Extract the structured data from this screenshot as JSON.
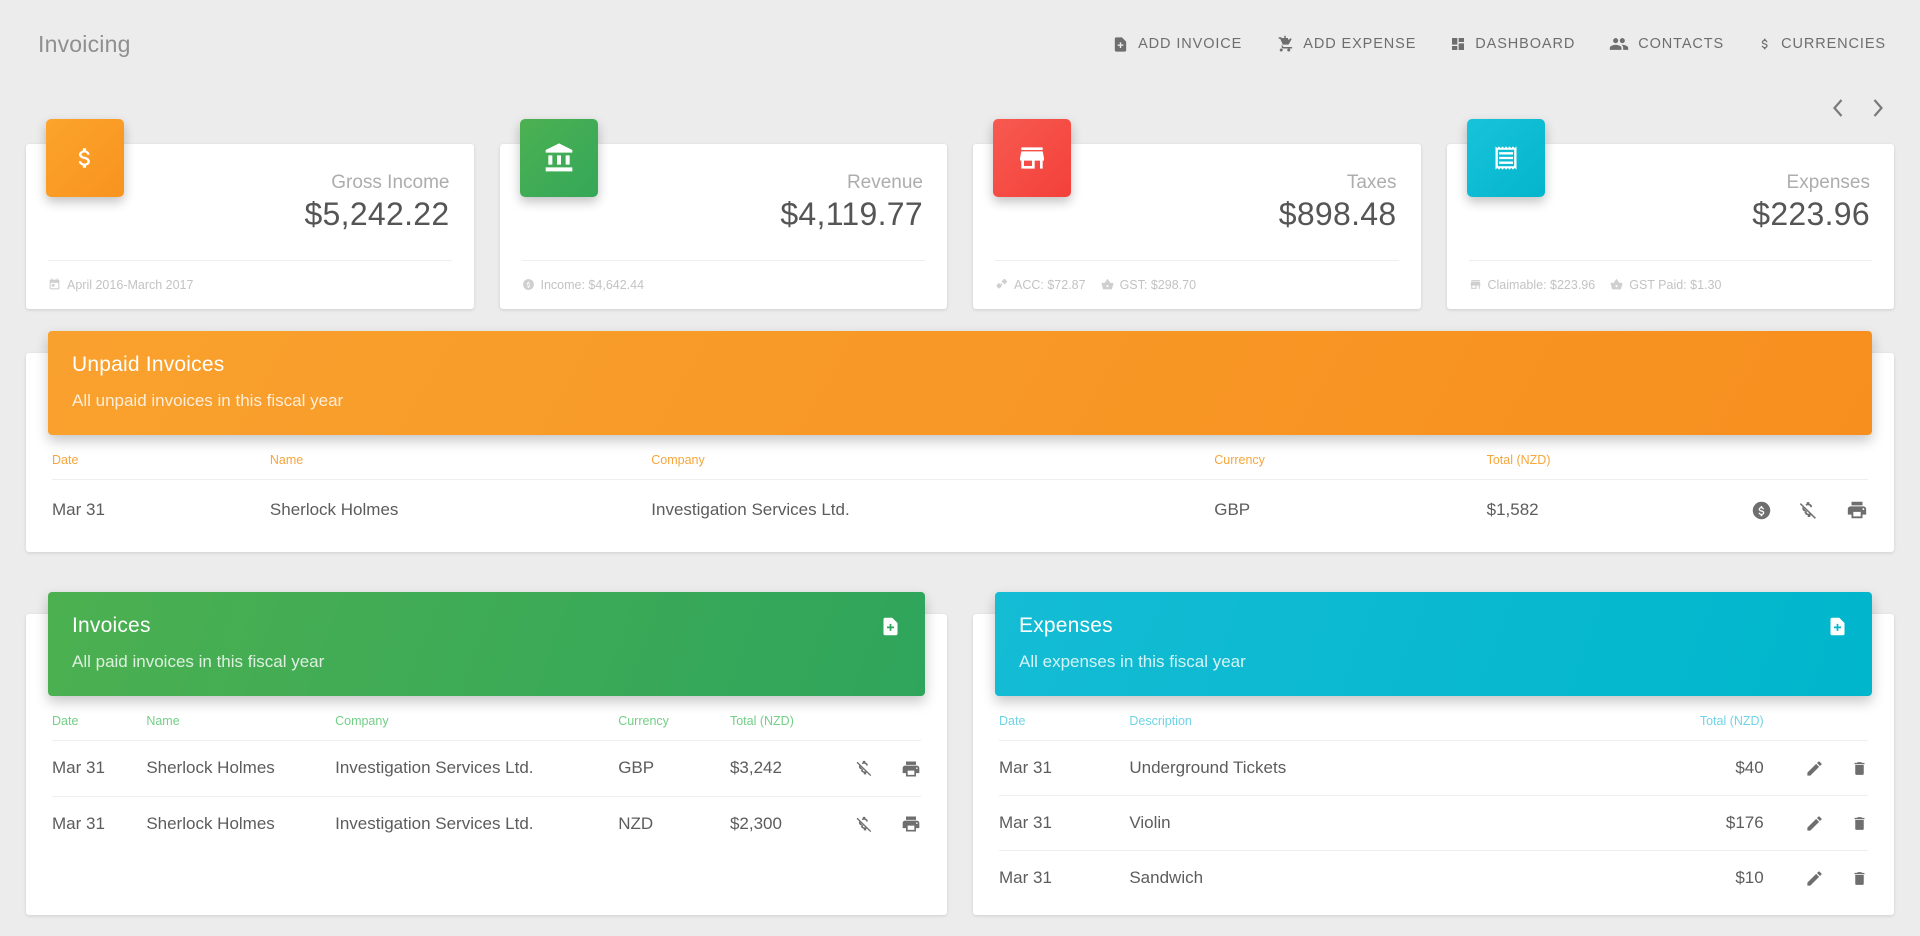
{
  "app": {
    "title": "Invoicing"
  },
  "nav": {
    "items": [
      {
        "label": "ADD INVOICE",
        "icon": "file-add-icon"
      },
      {
        "label": "ADD EXPENSE",
        "icon": "cart-add-icon"
      },
      {
        "label": "DASHBOARD",
        "icon": "dashboard-icon"
      },
      {
        "label": "CONTACTS",
        "icon": "contacts-icon"
      },
      {
        "label": "CURRENCIES",
        "icon": "dollar-sign-icon"
      }
    ]
  },
  "pager": {
    "prev": "chevron-left-icon",
    "next": "chevron-right-icon"
  },
  "cards": [
    {
      "label": "Gross Income",
      "value": "$5,242.22",
      "color": "#f89b24",
      "icon": "dollar-sign-icon",
      "footer": [
        {
          "icon": "calendar-icon",
          "text": "April 2016-March 2017"
        }
      ]
    },
    {
      "label": "Revenue",
      "value": "$4,119.77",
      "color": "#3aa856",
      "icon": "bank-icon",
      "footer": [
        {
          "icon": "dollar-circle-icon",
          "text": "Income: $4,642.44"
        }
      ]
    },
    {
      "label": "Taxes",
      "value": "$898.48",
      "color": "#f4463f",
      "icon": "store-icon",
      "footer": [
        {
          "icon": "bandage-icon",
          "text": "ACC: $72.87"
        },
        {
          "icon": "basket-icon",
          "text": "GST: $298.70"
        }
      ]
    },
    {
      "label": "Expenses",
      "value": "$223.96",
      "color": "#0cbcd5",
      "icon": "receipt-icon",
      "footer": [
        {
          "icon": "store-icon",
          "text": "Claimable: $223.96"
        },
        {
          "icon": "basket-icon",
          "text": "GST Paid: $1.30"
        }
      ]
    }
  ],
  "unpaid": {
    "title": "Unpaid Invoices",
    "subtitle": "All unpaid invoices in this fiscal year",
    "columns": [
      "Date",
      "Name",
      "Company",
      "Currency",
      "Total (NZD)"
    ],
    "rows": [
      {
        "date": "Mar 31",
        "name": "Sherlock Holmes",
        "company": "Investigation Services Ltd.",
        "currency": "GBP",
        "total": "$1,582",
        "actions": [
          "dollar-circle-icon",
          "dollar-slash-icon",
          "print-icon"
        ]
      }
    ]
  },
  "invoices": {
    "title": "Invoices",
    "subtitle": "All paid invoices in this fiscal year",
    "add_icon": "file-add-icon",
    "columns": [
      "Date",
      "Name",
      "Company",
      "Currency",
      "Total (NZD)"
    ],
    "rows": [
      {
        "date": "Mar 31",
        "name": "Sherlock Holmes",
        "company": "Investigation Services Ltd.",
        "currency": "GBP",
        "total": "$3,242",
        "actions": [
          "dollar-slash-icon",
          "print-icon"
        ]
      },
      {
        "date": "Mar 31",
        "name": "Sherlock Holmes",
        "company": "Investigation Services Ltd.",
        "currency": "NZD",
        "total": "$2,300",
        "actions": [
          "dollar-slash-icon",
          "print-icon"
        ]
      }
    ]
  },
  "expenses": {
    "title": "Expenses",
    "subtitle": "All expenses in this fiscal year",
    "add_icon": "file-add-icon",
    "columns": [
      "Date",
      "Description",
      "Total (NZD)"
    ],
    "rows": [
      {
        "date": "Mar 31",
        "description": "Underground Tickets",
        "total": "$40",
        "actions": [
          "edit-icon",
          "delete-icon"
        ]
      },
      {
        "date": "Mar 31",
        "description": "Violin",
        "total": "$176",
        "actions": [
          "edit-icon",
          "delete-icon"
        ]
      },
      {
        "date": "Mar 31",
        "description": "Sandwich",
        "total": "$10",
        "actions": [
          "edit-icon",
          "delete-icon"
        ]
      }
    ]
  }
}
